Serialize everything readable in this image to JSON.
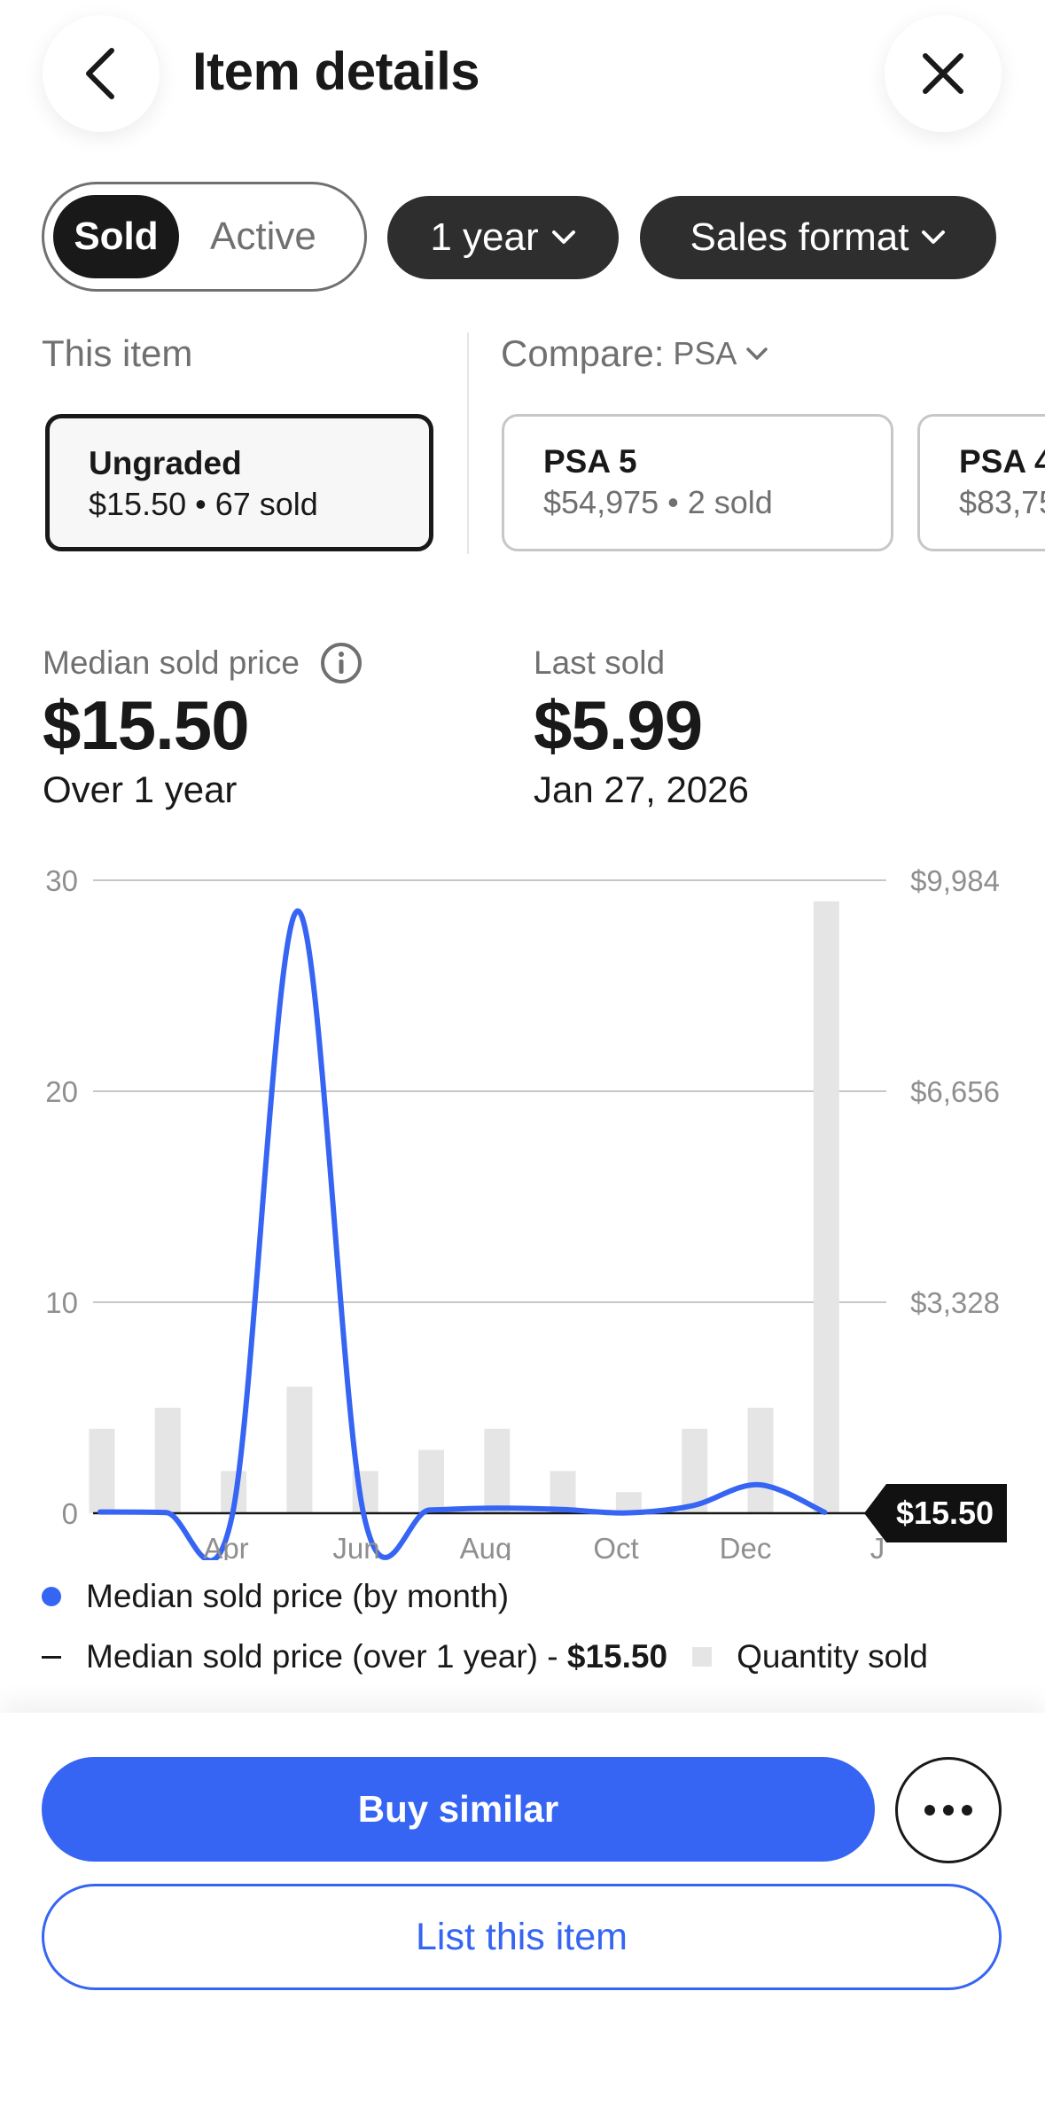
{
  "header": {
    "title": "Item details",
    "back_icon": "chevron-left-icon",
    "close_icon": "close-icon"
  },
  "filters": {
    "segments": [
      "Sold",
      "Active"
    ],
    "selected_segment": "Sold",
    "period": "1 year",
    "format": "Sales format"
  },
  "comparison": {
    "this_item_label": "This item",
    "compare_label": "Compare:",
    "compare_value": "PSA",
    "cards": [
      {
        "title": "Ungraded",
        "subtitle": "$15.50 • 67 sold",
        "selected": true
      },
      {
        "title": "PSA 5",
        "subtitle": "$54,975 • 2 sold",
        "selected": false
      },
      {
        "title": "PSA 4",
        "subtitle": "$83,75",
        "selected": false
      }
    ]
  },
  "stats": {
    "median_label": "Median sold price",
    "median_value": "$15.50",
    "median_period": "Over 1 year",
    "last_label": "Last sold",
    "last_value": "$5.99",
    "last_date": "Jan 27, 2026"
  },
  "chart_data": {
    "type": "bar",
    "left_axis": {
      "ticks": [
        0,
        10,
        20,
        30
      ],
      "ylim": [
        0,
        30
      ]
    },
    "right_axis": {
      "ticks": [
        "",
        "$3,328",
        "$6,656",
        "$9,984"
      ],
      "ylim": [
        0,
        9984
      ]
    },
    "x_labels": [
      "Apr",
      "Jun",
      "Aug",
      "Oct",
      "Dec",
      "J"
    ],
    "series": [
      {
        "name": "Quantity sold",
        "type": "bar",
        "axis": "left",
        "values": [
          4,
          5,
          2,
          6,
          2,
          3,
          4,
          2,
          1,
          4,
          5,
          29
        ]
      },
      {
        "name": "Median sold price (by month)",
        "type": "line",
        "axis": "right",
        "values": [
          20,
          10,
          -60,
          9500,
          -10,
          50,
          80,
          60,
          5,
          120,
          450,
          15
        ]
      }
    ],
    "reference_line": {
      "name": "Median sold price (over 1 year)",
      "value": 15.5,
      "label": "$15.50"
    },
    "grid": true
  },
  "legend": {
    "line_label": "Median sold price (by month)",
    "median_prefix": "Median sold price (over 1 year) - ",
    "median_value": "$15.50",
    "quantity_label": "Quantity sold"
  },
  "actions": {
    "buy_label": "Buy similar",
    "list_label": "List this item",
    "more_icon": "more-horizontal-icon"
  },
  "colors": {
    "accent": "#3665f3",
    "dark": "#191919",
    "bar": "#e5e5e5",
    "grey_text": "#707070"
  }
}
